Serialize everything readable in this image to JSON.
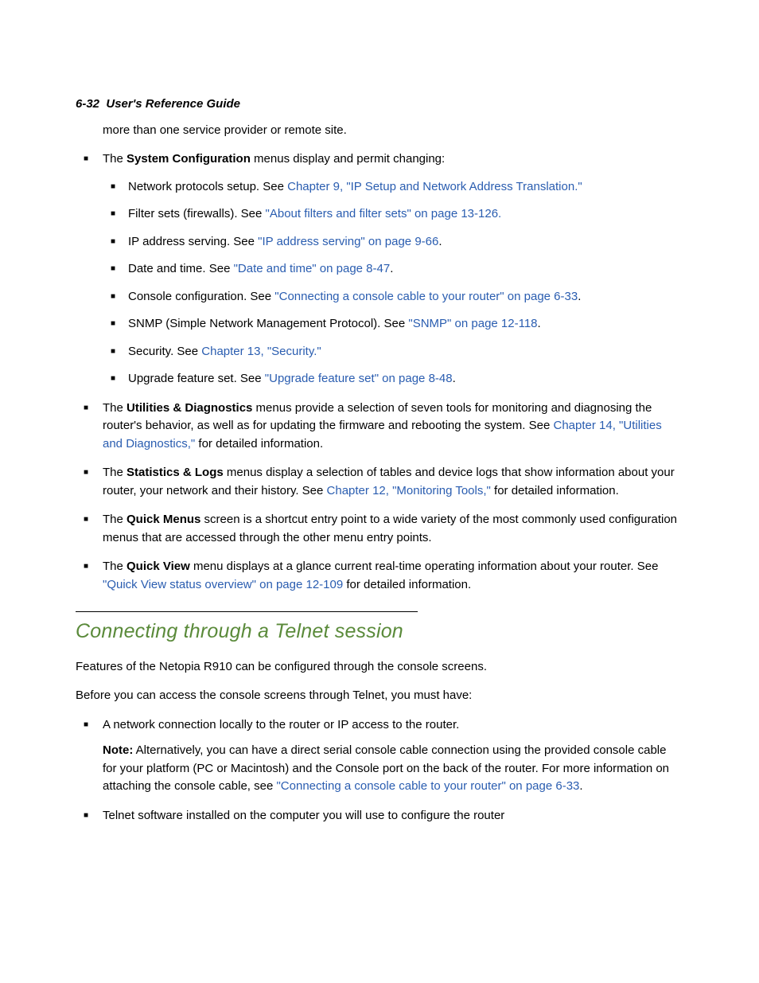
{
  "header": {
    "page_label": "6-32",
    "title": "User's Reference Guide"
  },
  "continuation": "more than one service provider or remote site.",
  "top_list": [
    {
      "pre": "The ",
      "bold": "System Configuration",
      "post": " menus display and permit changing:",
      "sub": [
        {
          "pre": "Network protocols setup. See ",
          "link": "Chapter 9, \"IP Setup and Network Address Translation.\"",
          "post": ""
        },
        {
          "pre": "Filter sets (firewalls). See ",
          "link": "\"About filters and filter sets\" on page 13-126.",
          "post": ""
        },
        {
          "pre": "IP address serving. See ",
          "link": "\"IP address serving\" on page 9-66",
          "post": "."
        },
        {
          "pre": "Date and time. See ",
          "link": "\"Date and time\" on page 8-47",
          "post": "."
        },
        {
          "pre": "Console configuration. See ",
          "link": "\"Connecting a console cable to your router\" on page 6-33",
          "post": "."
        },
        {
          "pre": "SNMP (Simple Network Management Protocol). See ",
          "link": "\"SNMP\" on page 12-118",
          "post": "."
        },
        {
          "pre": "Security. See ",
          "link": "Chapter 13, \"Security.\"",
          "post": ""
        },
        {
          "pre": "Upgrade feature set. See ",
          "link": "\"Upgrade feature set\" on page 8-48",
          "post": "."
        }
      ]
    },
    {
      "pre": "The ",
      "bold": "Utilities & Diagnostics",
      "post_a": " menus provide a selection of seven tools for monitoring and diagnosing the router's behavior, as well as for updating the firmware and rebooting the system. See ",
      "link": "Chapter 14, \"Utilities and Diagnostics,\"",
      "post_b": " for detailed information."
    },
    {
      "pre": "The ",
      "bold": "Statistics & Logs",
      "post_a": " menus display a selection of tables and device logs that show information about your router, your network and their history. See ",
      "link": "Chapter 12, \"Monitoring Tools,\"",
      "post_b": " for detailed information."
    },
    {
      "pre": "The ",
      "bold": "Quick Menus",
      "post_a": " screen is a shortcut entry point to a wide variety of the most commonly used configuration menus that are accessed through the other menu entry points.",
      "link": "",
      "post_b": ""
    },
    {
      "pre": "The ",
      "bold": "Quick View",
      "post_a": " menu displays at a glance current real-time operating information about your router. See ",
      "link": "\"Quick View status overview\" on page 12-109",
      "post_b": " for detailed information."
    }
  ],
  "section": {
    "title": "Connecting through a Telnet session",
    "p1": "Features of the Netopia R910 can be configured through the console screens.",
    "p2": "Before you can access the console screens through Telnet, you must have:",
    "list": [
      {
        "text": "A network connection locally to the router or IP access to the router.",
        "note_bold": "Note:",
        "note_pre": " Alternatively, you can have a direct serial console cable connection using the provided console cable for your platform (PC or Macintosh) and the Console port on the back of the router. For more information on attaching the console cable, see ",
        "note_link": "\"Connecting a console cable to your router\" on page 6-33",
        "note_post": "."
      },
      {
        "text": "Telnet software installed on the computer you will use to configure the router"
      }
    ]
  }
}
